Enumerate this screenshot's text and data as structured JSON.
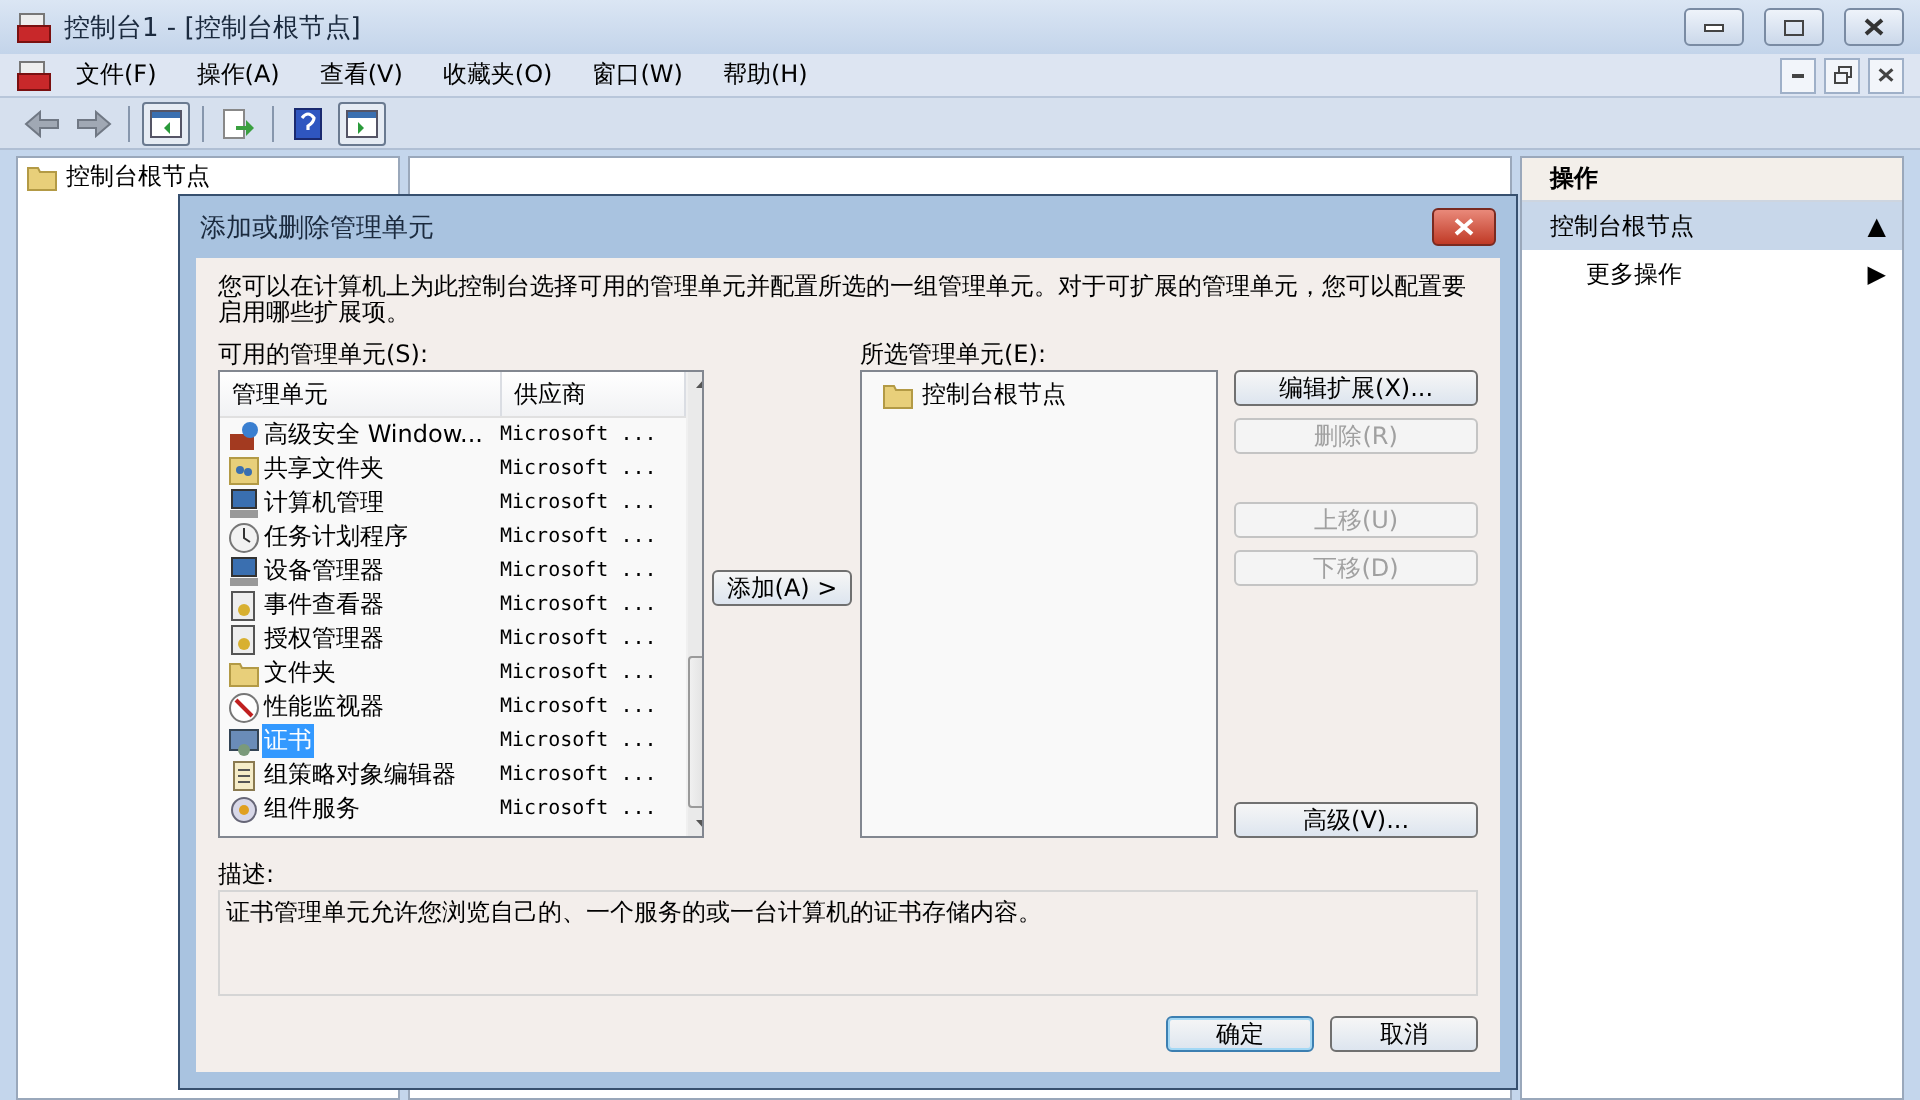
{
  "window": {
    "title": "控制台1 - [控制台根节点]"
  },
  "menu": [
    "文件(F)",
    "操作(A)",
    "查看(V)",
    "收藏夹(O)",
    "窗口(W)",
    "帮助(H)"
  ],
  "tree": {
    "items": [
      {
        "label": "控制台根节点",
        "selected": false
      }
    ]
  },
  "actions_pane": {
    "header": "操作",
    "items": [
      {
        "label": "控制台根节点",
        "kind": "section",
        "arrow": "▲"
      },
      {
        "label": "更多操作",
        "kind": "item",
        "arrow": "▶"
      }
    ]
  },
  "dialog": {
    "title": "添加或删除管理单元",
    "intro": "您可以在计算机上为此控制台选择可用的管理单元并配置所选的一组管理单元。对于可扩展的管理单元，您可以配置要启用哪些扩展项。",
    "available": {
      "label": "可用的管理单元(S):",
      "columns": [
        "管理单元",
        "供应商"
      ],
      "rows": [
        {
          "name": "高级安全 Window...",
          "vendor": "Microsoft ...",
          "kind": "firewall",
          "selected": false
        },
        {
          "name": "共享文件夹",
          "vendor": "Microsoft ...",
          "kind": "share",
          "selected": false
        },
        {
          "name": "计算机管理",
          "vendor": "Microsoft ...",
          "kind": "computer",
          "selected": false
        },
        {
          "name": "任务计划程序",
          "vendor": "Microsoft ...",
          "kind": "clock",
          "selected": false
        },
        {
          "name": "设备管理器",
          "vendor": "Microsoft ...",
          "kind": "computer",
          "selected": false
        },
        {
          "name": "事件查看器",
          "vendor": "Microsoft ...",
          "kind": "log",
          "selected": false
        },
        {
          "name": "授权管理器",
          "vendor": "Microsoft ...",
          "kind": "log",
          "selected": false
        },
        {
          "name": "文件夹",
          "vendor": "Microsoft ...",
          "kind": "folder",
          "selected": false
        },
        {
          "name": "性能监视器",
          "vendor": "Microsoft ...",
          "kind": "gauge",
          "selected": false
        },
        {
          "name": "证书",
          "vendor": "Microsoft ...",
          "kind": "certificate",
          "selected": true
        },
        {
          "name": "组策略对象编辑器",
          "vendor": "Microsoft ...",
          "kind": "scroll",
          "selected": false
        },
        {
          "name": "组件服务",
          "vendor": "Microsoft ...",
          "kind": "gear",
          "selected": false
        }
      ]
    },
    "add_button": "添加(A) >",
    "selected_list": {
      "label": "所选管理单元(E):",
      "items": [
        {
          "label": "控制台根节点"
        }
      ]
    },
    "side_buttons": [
      {
        "label": "编辑扩展(X)...",
        "disabled": false
      },
      {
        "label": "删除(R)",
        "disabled": true
      },
      {
        "label": "上移(U)",
        "disabled": true
      },
      {
        "label": "下移(D)",
        "disabled": true
      },
      {
        "label": "高级(V)...",
        "disabled": false
      }
    ],
    "description": {
      "label": "描述:",
      "text": "证书管理单元允许您浏览自己的、一个服务的或一台计算机的证书存储内容。"
    },
    "footer_buttons": [
      {
        "label": "确定",
        "default": true
      },
      {
        "label": "取消",
        "default": false
      }
    ]
  }
}
